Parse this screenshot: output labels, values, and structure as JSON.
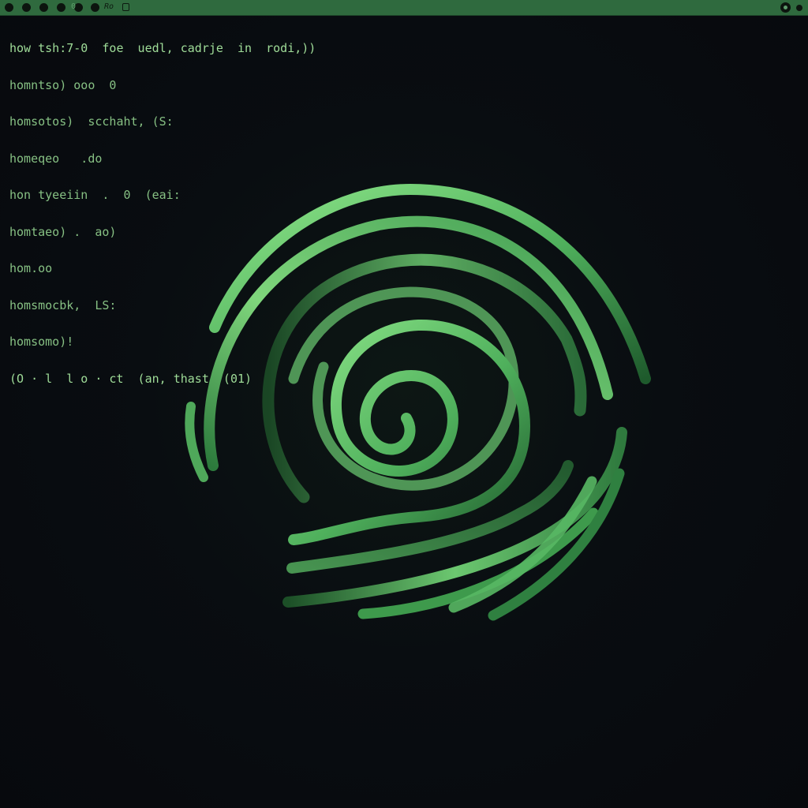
{
  "window": {
    "titlebar_color": "#2f6a3e",
    "background_color": "#080b10",
    "titlebar_icons": [
      "circle-button",
      "circle-button",
      "circle-button",
      "circle-button",
      "circle-button",
      "circle-button",
      "o-glyph",
      "script-glyph",
      "square-glyph",
      "settings-ring-icon",
      "menu-dot-icon"
    ],
    "titlebar_glyph_o": "0",
    "titlebar_glyph_script": "Ro"
  },
  "terminal": {
    "text_color": "#9fdc98",
    "lines": [
      "how tsh:7-0  foe  uedl, cadrje  in  rodi,))",
      "homntso) ooo  0",
      "homsotos)  scchaht, (S:",
      "homeqeo   .do",
      "hon tyeeiin  .  0  (eai:",
      "homtaeo) .  ao)",
      "hom.oo",
      "homsmocbk,  LS:",
      "homsomo)!",
      "(O · l  l o · ct  (an, thast  (01)"
    ]
  },
  "logo": {
    "icon": "green-spiral-logo",
    "color_light": "#8ee68a",
    "color_mid": "#4fb05c",
    "color_dark": "#1e5a2c"
  }
}
